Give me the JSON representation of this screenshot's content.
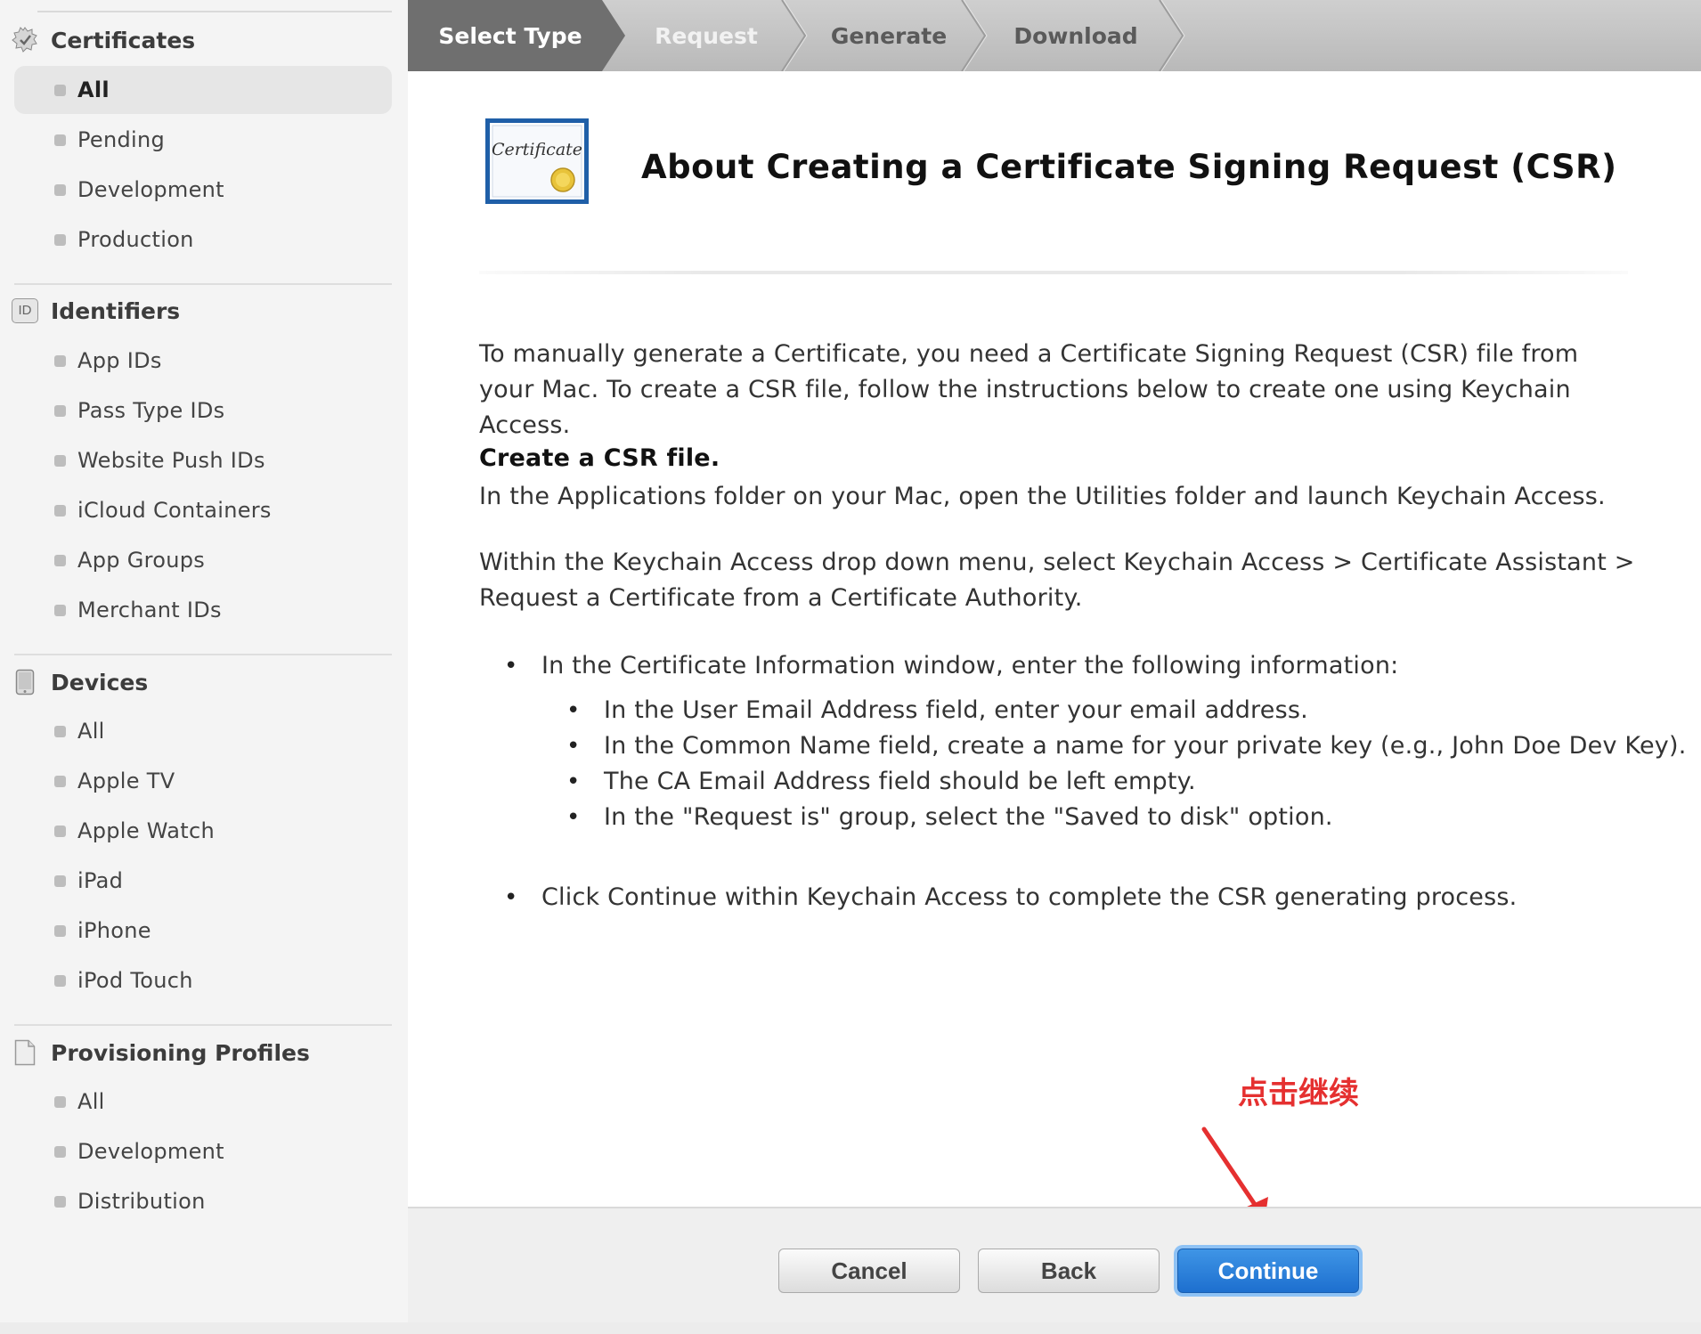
{
  "sidebar": {
    "sections": [
      {
        "title": "Certificates",
        "icon": "certificate-badge-icon",
        "items": [
          "All",
          "Pending",
          "Development",
          "Production"
        ]
      },
      {
        "title": "Identifiers",
        "icon": "id-badge-icon",
        "icon_text": "ID",
        "items": [
          "App IDs",
          "Pass Type IDs",
          "Website Push IDs",
          "iCloud Containers",
          "App Groups",
          "Merchant IDs"
        ]
      },
      {
        "title": "Devices",
        "icon": "device-icon",
        "items": [
          "All",
          "Apple TV",
          "Apple Watch",
          "iPad",
          "iPhone",
          "iPod Touch"
        ]
      },
      {
        "title": "Provisioning Profiles",
        "icon": "document-icon",
        "items": [
          "All",
          "Development",
          "Distribution"
        ]
      }
    ],
    "active_item": "Certificates / All"
  },
  "steps": [
    "Select Type",
    "Request",
    "Generate",
    "Download"
  ],
  "active_step": "Select Type",
  "main": {
    "title": "About Creating a Certificate Signing Request (CSR)",
    "cert_image_text": "Certificate",
    "intro": "To manually generate a Certificate, you need a Certificate Signing Request (CSR) file from your Mac. To create a CSR file, follow the instructions below to create one using Keychain Access.",
    "subhead": "Create a CSR file.",
    "para1": "In the Applications folder on your Mac, open the Utilities folder and launch Keychain Access.",
    "para2": "Within the Keychain Access drop down menu, select Keychain Access > Certificate Assistant > Request a Certificate from a Certificate Authority.",
    "bullet1": "In the Certificate Information window, enter the following information:",
    "sub_bullets": [
      "In the User Email Address field, enter your email address.",
      "In the Common Name field, create a name for your private key (e.g., John Doe Dev Key).",
      "The CA Email Address field should be left empty.",
      "In the \"Request is\" group, select the \"Saved to disk\" option."
    ],
    "bullet2": "Click Continue within Keychain Access to complete the CSR generating process."
  },
  "annotation": "点击继续",
  "footer": {
    "cancel": "Cancel",
    "back": "Back",
    "continue": "Continue"
  },
  "colors": {
    "accent": "#1d6fcf",
    "annotation": "#e53030",
    "step_active": "#6f6f6f"
  }
}
